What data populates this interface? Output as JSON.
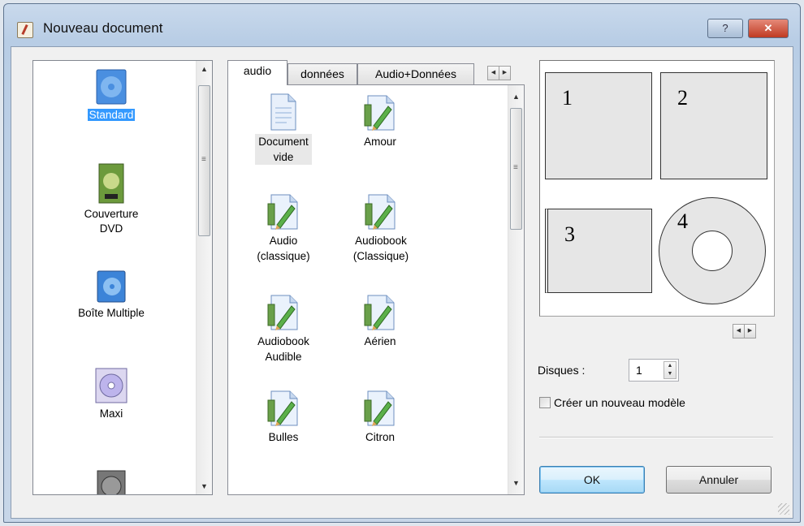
{
  "window": {
    "title": "Nouveau document",
    "help_label": "?",
    "close_label": "✕"
  },
  "left_list": {
    "items": [
      {
        "label": "Standard",
        "icon": "standard-case-icon",
        "selected": true
      },
      {
        "label": "Couverture\nDVD",
        "icon": "dvd-cover-icon"
      },
      {
        "label": "Boîte Multiple",
        "icon": "multi-box-icon"
      },
      {
        "label": "Maxi",
        "icon": "maxi-cd-icon"
      },
      {
        "label": "",
        "icon": "disc-case-icon"
      }
    ]
  },
  "tabs": [
    {
      "label": "audio",
      "active": true
    },
    {
      "label": "données"
    },
    {
      "label": "Audio+Données"
    }
  ],
  "files": [
    {
      "label": "Document\nvide",
      "icon": "blank-document-icon"
    },
    {
      "label": "Amour",
      "icon": "template-edit-icon"
    },
    {
      "label": "Audio\n(classique)",
      "icon": "template-edit-icon"
    },
    {
      "label": "Audiobook\n(Classique)",
      "icon": "template-edit-icon"
    },
    {
      "label": "Audiobook\nAudible",
      "icon": "template-edit-icon"
    },
    {
      "label": "Aérien",
      "icon": "template-edit-icon"
    },
    {
      "label": "Bulles",
      "icon": "template-edit-icon"
    },
    {
      "label": "Citron",
      "icon": "template-edit-icon"
    }
  ],
  "preview": {
    "labels": [
      "1",
      "2",
      "3",
      "4"
    ]
  },
  "disques": {
    "label": "Disques :",
    "value": "1"
  },
  "new_template_checkbox": {
    "label": "Créer un nouveau modèle",
    "checked": false
  },
  "buttons": {
    "ok": "OK",
    "cancel": "Annuler"
  },
  "colors": {
    "selection": "#3399ff",
    "ok_border": "#3c7fb1"
  }
}
